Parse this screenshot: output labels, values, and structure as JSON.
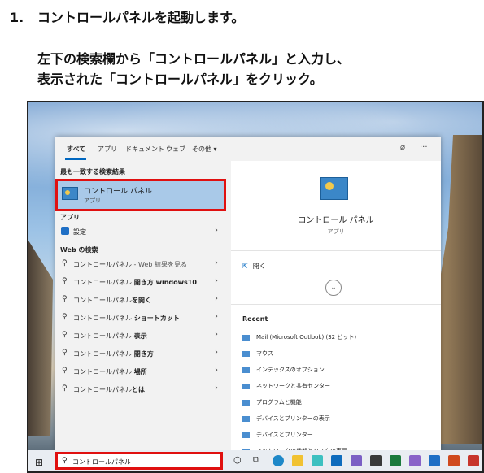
{
  "step": {
    "number": "1.",
    "title": "コントロールパネルを起動します。"
  },
  "instruction": {
    "line1": "左下の検索欄から「コントロールパネル」と入力し、",
    "line2": "表示された「コントロールパネル」をクリック。"
  },
  "tabs": [
    "すべて",
    "アプリ",
    "ドキュメント",
    "ウェブ",
    "その他 ▾"
  ],
  "tab_icons": {
    "feedback": "⌀",
    "more": "···"
  },
  "left": {
    "best_match_header": "最も一致する検索結果",
    "best_match": {
      "title": "コントロール パネル",
      "subtitle": "アプリ"
    },
    "apps_header": "アプリ",
    "settings_label": "設定",
    "web_header": "Web の検索",
    "web_items": [
      {
        "bold": "コントロールパネル",
        "rest": " - Web 結果を見る",
        "rest_is_sub": true
      },
      {
        "bold": "コントロールパネル",
        "rest": " 開き方 windows10"
      },
      {
        "bold": "コントロールパネル",
        "rest": "を開く"
      },
      {
        "bold": "コントロールパネル",
        "rest": " ショートカット"
      },
      {
        "bold": "コントロールパネル",
        "rest": " 表示"
      },
      {
        "bold": "コントロールパネル",
        "rest": " 開き方"
      },
      {
        "bold": "コントロールパネル",
        "rest": " 場所"
      },
      {
        "bold": "コントロールパネル",
        "rest": "とは"
      }
    ]
  },
  "right": {
    "title": "コントロール パネル",
    "subtitle": "アプリ",
    "open_label": "開く",
    "recent_header": "Recent",
    "recent_items": [
      "Mail (Microsoft Outlook) (32 ビット)",
      "マウス",
      "インデックスのオプション",
      "ネットワークと共有センター",
      "プログラムと機能",
      "デバイスとプリンターの表示",
      "デバイスとプリンター",
      "ネットワークの状態とタスクの表示"
    ]
  },
  "taskbar": {
    "search_value": "コントロールパネル"
  }
}
